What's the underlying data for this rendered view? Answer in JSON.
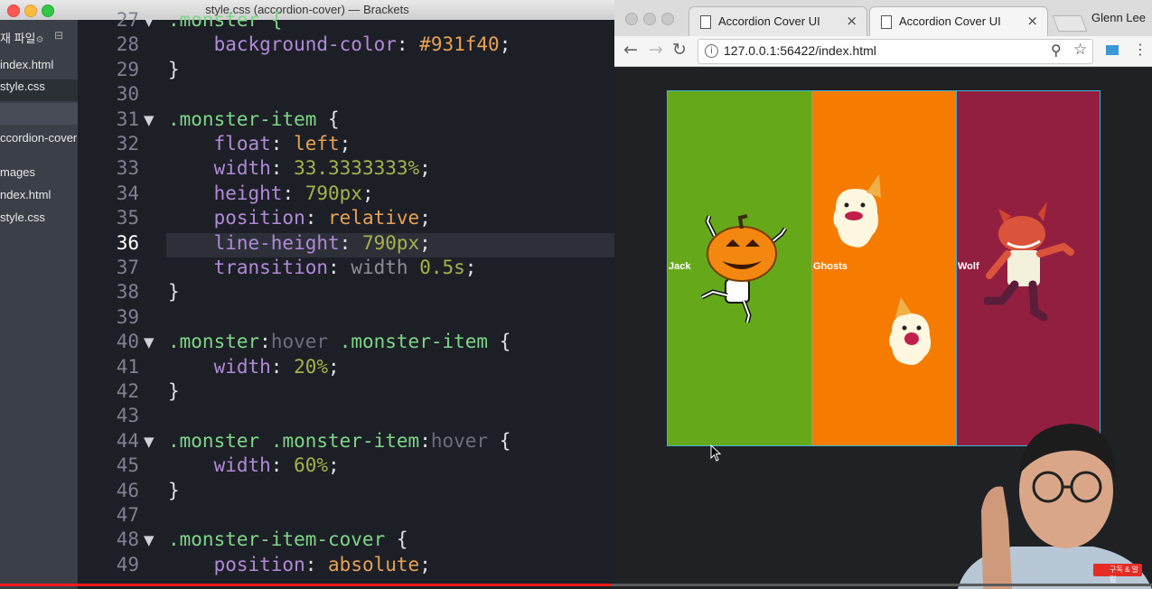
{
  "editor": {
    "window_title": "style.css (accordion-cover) — Brackets",
    "sidebar": {
      "working_files_header": "재 파일",
      "working_files": [
        "index.html",
        "style.css"
      ],
      "project_name": "ccordion-cover",
      "tree": [
        "mages",
        "ndex.html",
        "style.css"
      ]
    },
    "current_line": "36",
    "lines": [
      {
        "n": "27",
        "fold": true,
        "tokens": [
          {
            "t": ".monster {",
            "c": "sel"
          }
        ]
      },
      {
        "n": "28",
        "tokens": [
          {
            "t": "    "
          },
          {
            "t": "background-color",
            "c": "prop"
          },
          {
            "t": ": "
          },
          {
            "t": "#931f40",
            "c": "hex"
          },
          {
            "t": ";"
          }
        ]
      },
      {
        "n": "29",
        "tokens": [
          {
            "t": "}"
          }
        ]
      },
      {
        "n": "30",
        "tokens": []
      },
      {
        "n": "31",
        "fold": true,
        "tokens": [
          {
            "t": ".monster-item",
            "c": "sel"
          },
          {
            "t": " {"
          }
        ]
      },
      {
        "n": "32",
        "tokens": [
          {
            "t": "    "
          },
          {
            "t": "float",
            "c": "prop"
          },
          {
            "t": ": "
          },
          {
            "t": "left",
            "c": "val"
          },
          {
            "t": ";"
          }
        ]
      },
      {
        "n": "33",
        "tokens": [
          {
            "t": "    "
          },
          {
            "t": "width",
            "c": "prop"
          },
          {
            "t": ": "
          },
          {
            "t": "33.3333333%",
            "c": "num"
          },
          {
            "t": ";"
          }
        ]
      },
      {
        "n": "34",
        "tokens": [
          {
            "t": "    "
          },
          {
            "t": "height",
            "c": "prop"
          },
          {
            "t": ": "
          },
          {
            "t": "790px",
            "c": "num"
          },
          {
            "t": ";"
          }
        ]
      },
      {
        "n": "35",
        "tokens": [
          {
            "t": "    "
          },
          {
            "t": "position",
            "c": "prop"
          },
          {
            "t": ": "
          },
          {
            "t": "relative",
            "c": "val"
          },
          {
            "t": ";"
          }
        ]
      },
      {
        "n": "36",
        "tokens": [
          {
            "t": "    "
          },
          {
            "t": "line-height",
            "c": "prop"
          },
          {
            "t": ": "
          },
          {
            "t": "790px",
            "c": "num"
          },
          {
            "t": ";"
          }
        ]
      },
      {
        "n": "37",
        "tokens": [
          {
            "t": "    "
          },
          {
            "t": "transition",
            "c": "prop"
          },
          {
            "t": ": "
          },
          {
            "t": "width",
            "c": "ident"
          },
          {
            "t": " "
          },
          {
            "t": "0.5s",
            "c": "num"
          },
          {
            "t": ";"
          }
        ]
      },
      {
        "n": "38",
        "tokens": [
          {
            "t": "}"
          }
        ]
      },
      {
        "n": "39",
        "tokens": []
      },
      {
        "n": "40",
        "fold": true,
        "tokens": [
          {
            "t": ".monster",
            "c": "sel"
          },
          {
            "t": ":"
          },
          {
            "t": "hover",
            "c": "pseudo"
          },
          {
            "t": " "
          },
          {
            "t": ".monster-item",
            "c": "sel"
          },
          {
            "t": " {"
          }
        ]
      },
      {
        "n": "41",
        "tokens": [
          {
            "t": "    "
          },
          {
            "t": "width",
            "c": "prop"
          },
          {
            "t": ": "
          },
          {
            "t": "20%",
            "c": "num"
          },
          {
            "t": ";"
          }
        ]
      },
      {
        "n": "42",
        "tokens": [
          {
            "t": "}"
          }
        ]
      },
      {
        "n": "43",
        "tokens": []
      },
      {
        "n": "44",
        "fold": true,
        "tokens": [
          {
            "t": ".monster",
            "c": "sel"
          },
          {
            "t": " "
          },
          {
            "t": ".monster-item",
            "c": "sel"
          },
          {
            "t": ":"
          },
          {
            "t": "hover",
            "c": "pseudo"
          },
          {
            "t": " {"
          }
        ]
      },
      {
        "n": "45",
        "tokens": [
          {
            "t": "    "
          },
          {
            "t": "width",
            "c": "prop"
          },
          {
            "t": ": "
          },
          {
            "t": "60%",
            "c": "num"
          },
          {
            "t": ";"
          }
        ]
      },
      {
        "n": "46",
        "tokens": [
          {
            "t": "}"
          }
        ]
      },
      {
        "n": "47",
        "tokens": []
      },
      {
        "n": "48",
        "fold": true,
        "tokens": [
          {
            "t": ".monster-item-cover",
            "c": "sel"
          },
          {
            "t": " {"
          }
        ]
      },
      {
        "n": "49",
        "tokens": [
          {
            "t": "    "
          },
          {
            "t": "position",
            "c": "prop"
          },
          {
            "t": ": "
          },
          {
            "t": "absolute",
            "c": "val"
          },
          {
            "t": ";"
          }
        ]
      }
    ]
  },
  "browser": {
    "tabs": [
      {
        "title": "Accordion Cover UI",
        "active": false
      },
      {
        "title": "Accordion Cover UI",
        "active": true
      }
    ],
    "profile_name": "Glenn Lee",
    "url": "127.0.0.1:56422/index.html",
    "page": {
      "items": [
        {
          "label": "Jack",
          "color": "#65a91a",
          "art": "pumpkin-skeleton"
        },
        {
          "label": "Ghosts",
          "color": "#f57c00",
          "art": "ghosts"
        },
        {
          "label": "Wolf",
          "color": "#931f40",
          "art": "werewolf"
        }
      ]
    }
  },
  "video": {
    "progress_fraction": 0.53
  },
  "colors": {
    "accordion_border": "#3fb4d6",
    "editor_bg": "#1d1f26",
    "selector": "#7dd787",
    "property": "#b08ad8",
    "value": "#e7a254",
    "number": "#a4b34a"
  }
}
